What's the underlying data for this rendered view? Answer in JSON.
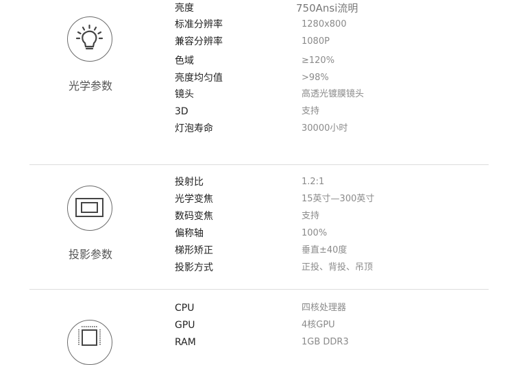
{
  "sections": [
    {
      "title": "光学参数",
      "icon": "lightbulb-icon",
      "rows": [
        {
          "label": "亮度",
          "value": "750Ansi流明"
        },
        {
          "label": "标准分辨率",
          "value": "1280x800"
        },
        {
          "label": "兼容分辨率",
          "value": "1080P"
        },
        {
          "label": "色域",
          "value": "≥120%"
        },
        {
          "label": "亮度均匀值",
          "value": ">98%"
        },
        {
          "label": "镜头",
          "value": "高透光镀膜镜头"
        },
        {
          "label": "3D",
          "value": "支持"
        },
        {
          "label": "灯泡寿命",
          "value": "30000小时"
        }
      ]
    },
    {
      "title": "投影参数",
      "icon": "projection-screen-icon",
      "rows": [
        {
          "label": "投射比",
          "value": "1.2:1"
        },
        {
          "label": "光学变焦",
          "value": "15英寸—300英寸"
        },
        {
          "label": "数码变焦",
          "value": "支持"
        },
        {
          "label": "偏称轴",
          "value": "100%"
        },
        {
          "label": "梯形矫正",
          "value": "垂直±40度"
        },
        {
          "label": "投影方式",
          "value": "正投、背投、吊顶"
        }
      ]
    },
    {
      "title": "",
      "icon": "cpu-chip-icon",
      "rows": [
        {
          "label": "CPU",
          "value": "四核处理器"
        },
        {
          "label": "GPU",
          "value": "4核GPU"
        },
        {
          "label": "RAM",
          "value": "1GB DDR3"
        }
      ]
    }
  ]
}
